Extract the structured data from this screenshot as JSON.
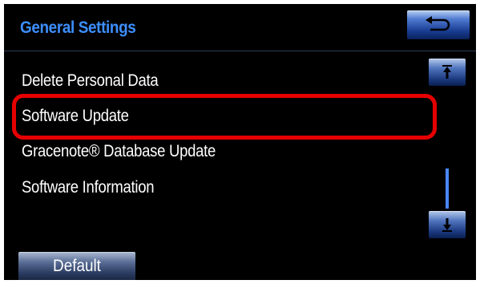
{
  "header": {
    "title": "General Settings"
  },
  "menu": {
    "items": [
      {
        "label": "Delete Personal Data"
      },
      {
        "label": "Software Update"
      },
      {
        "label": "Gracenote® Database Update"
      },
      {
        "label": "Software Information"
      }
    ],
    "highlighted_item": "Software Update"
  },
  "footer": {
    "default_label": "Default"
  },
  "icons": {
    "back": "back-arrow-icon",
    "scroll_up": "scroll-up-icon",
    "scroll_down": "scroll-down-icon"
  },
  "colors": {
    "title": "#3d8fff",
    "highlight": "#e60000",
    "background": "#000000",
    "text": "#ffffff"
  }
}
